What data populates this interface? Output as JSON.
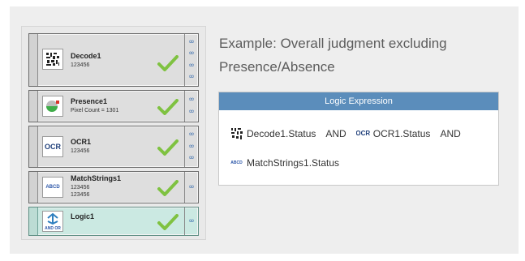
{
  "caption": {
    "line1": "Example: Overall judgment excluding",
    "line2": "Presence/Absence"
  },
  "steps": [
    {
      "name": "Decode1",
      "lines": [
        "123456"
      ],
      "icon": "barcode-icon",
      "status": "pass"
    },
    {
      "name": "Presence1",
      "lines": [
        "Pixel Count = 1301"
      ],
      "icon": "presence-icon",
      "status": "pass"
    },
    {
      "name": "OCR1",
      "lines": [
        "123456"
      ],
      "icon": "ocr-icon",
      "ocr_text": "OCR",
      "status": "pass"
    },
    {
      "name": "MatchStrings1",
      "lines": [
        "123456",
        "123456"
      ],
      "icon": "match-strings-icon",
      "icon_text": "ABCD",
      "status": "pass"
    },
    {
      "name": "Logic1",
      "lines": [],
      "icon": "logic-icon",
      "icon_text": "AND OR",
      "status": "pass",
      "selected": true
    }
  ],
  "logic_panel": {
    "title": "Logic Expression",
    "terms": [
      {
        "label": "Decode1.Status",
        "icon": "barcode-icon"
      },
      {
        "operator": "AND"
      },
      {
        "label": "OCR1.Status",
        "icon": "ocr-icon",
        "icon_text": "OCR"
      },
      {
        "operator": "AND"
      },
      {
        "label": "MatchStrings1.Status",
        "icon": "match-strings-icon",
        "icon_text": "ABCD"
      }
    ]
  },
  "colors": {
    "check": "#7fc241",
    "header": "#5b8dbb",
    "link": "#3d6fae",
    "selected": "#cbe9e2"
  }
}
